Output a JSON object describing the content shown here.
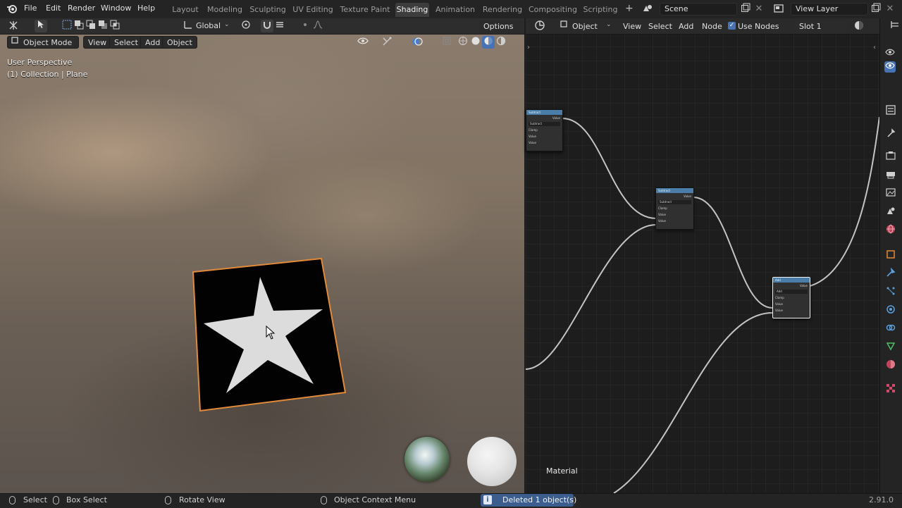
{
  "menubar": {
    "items": [
      "File",
      "Edit",
      "Render",
      "Window",
      "Help"
    ],
    "workspaces": [
      "Layout",
      "Modeling",
      "Sculpting",
      "UV Editing",
      "Texture Paint",
      "Shading",
      "Animation",
      "Rendering",
      "Compositing",
      "Scripting"
    ],
    "active_workspace": "Shading",
    "add_workspace": "+",
    "scene": "Scene",
    "view_layer": "View Layer"
  },
  "viewport": {
    "transform_orientation": "Global",
    "options_label": "Options",
    "mode": "Object Mode",
    "menu": [
      "View",
      "Select",
      "Add",
      "Object"
    ],
    "perspective_label": "User Perspective",
    "collection_label": "(1) Collection | Plane"
  },
  "node_editor": {
    "type": "Object",
    "menu": [
      "View",
      "Select",
      "Add",
      "Node"
    ],
    "use_nodes_label": "Use Nodes",
    "use_nodes_checked": true,
    "slot": "Slot 1",
    "material_label": "Material",
    "nodes": [
      {
        "title": "Subtract",
        "output": "Value",
        "operation": "Subtract",
        "clamp": "Clamp",
        "inputs": [
          "Value",
          "Value"
        ]
      },
      {
        "title": "Subtract",
        "output": "Value",
        "operation": "Subtract",
        "clamp": "Clamp",
        "inputs": [
          "Value",
          "Value"
        ]
      },
      {
        "title": "Add",
        "output": "Value",
        "operation": "Add",
        "clamp": "Clamp",
        "inputs": [
          "Value",
          "Value"
        ]
      }
    ]
  },
  "statusbar": {
    "select": "Select",
    "box_select": "Box Select",
    "rotate_view": "Rotate View",
    "context_menu": "Object Context Menu",
    "message": "Deleted 1 object(s)",
    "version": "2.91.0"
  },
  "colors": {
    "accent": "#4772b3",
    "node_header": "#4a7ea8",
    "selection_outline": "#e08a3a"
  }
}
